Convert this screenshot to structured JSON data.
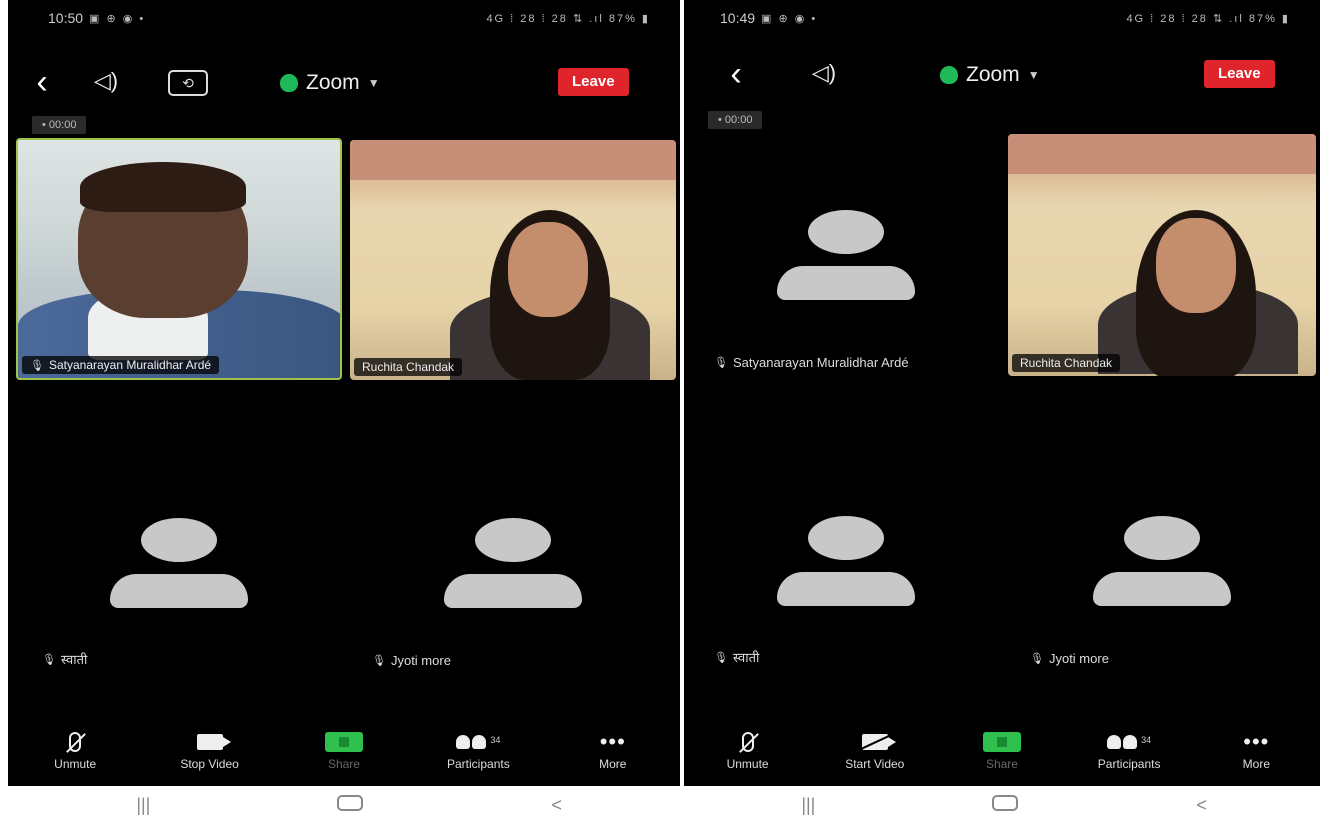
{
  "left": {
    "status": {
      "time": "10:50",
      "left_icons": "▣ ⊕ ◉ •",
      "right_icons": "4G ⁞ 28 ⁞ 28 ⇅ .ıl 87% ▮"
    },
    "topbar": {
      "back": "‹",
      "speaker_icon": "speaker-icon",
      "camera_flip_icon": "camera-flip-icon",
      "title": "Zoom",
      "leave": "Leave"
    },
    "timer": "• 00:00",
    "tiles": [
      {
        "name": "Satyanarayan Muralidhar Ardé",
        "type": "video",
        "active": true
      },
      {
        "name": "Ruchita Chandak",
        "type": "video",
        "active": false
      },
      {
        "name": "स्वाती",
        "type": "avatar"
      },
      {
        "name": "Jyoti more",
        "type": "avatar"
      }
    ],
    "toolbar": [
      {
        "label": "Unmute",
        "icon": "mic-muted-icon"
      },
      {
        "label": "Stop Video",
        "icon": "video-camera-icon"
      },
      {
        "label": "Share",
        "icon": "share-screen-icon"
      },
      {
        "label": "Participants",
        "icon": "participants-icon",
        "count": "34"
      },
      {
        "label": "More",
        "icon": "more-icon"
      }
    ]
  },
  "right": {
    "status": {
      "time": "10:49",
      "left_icons": "▣ ⊕ ◉ •",
      "right_icons": "4G ⁞ 28 ⁞ 28 ⇅ .ıl 87% ▮"
    },
    "topbar": {
      "back": "‹",
      "speaker_icon": "speaker-icon",
      "title": "Zoom",
      "leave": "Leave"
    },
    "timer": "• 00:00",
    "tiles": [
      {
        "name": "Satyanarayan Muralidhar Ardé",
        "type": "avatar"
      },
      {
        "name": "Ruchita Chandak",
        "type": "video",
        "active": false
      },
      {
        "name": "स्वाती",
        "type": "avatar"
      },
      {
        "name": "Jyoti more",
        "type": "avatar"
      }
    ],
    "toolbar": [
      {
        "label": "Unmute",
        "icon": "mic-muted-icon"
      },
      {
        "label": "Start Video",
        "icon": "video-off-icon"
      },
      {
        "label": "Share",
        "icon": "share-screen-icon"
      },
      {
        "label": "Participants",
        "icon": "participants-icon",
        "count": "34"
      },
      {
        "label": "More",
        "icon": "more-icon"
      }
    ]
  },
  "nav": {
    "recents": "|||",
    "back": "<"
  },
  "colors": {
    "leave_red": "#e0242b",
    "share_green": "#2fbf4d",
    "shield_green": "#1fb95a",
    "active_border": "#9ec34a",
    "avatar_grey": "#c8c8c8"
  }
}
